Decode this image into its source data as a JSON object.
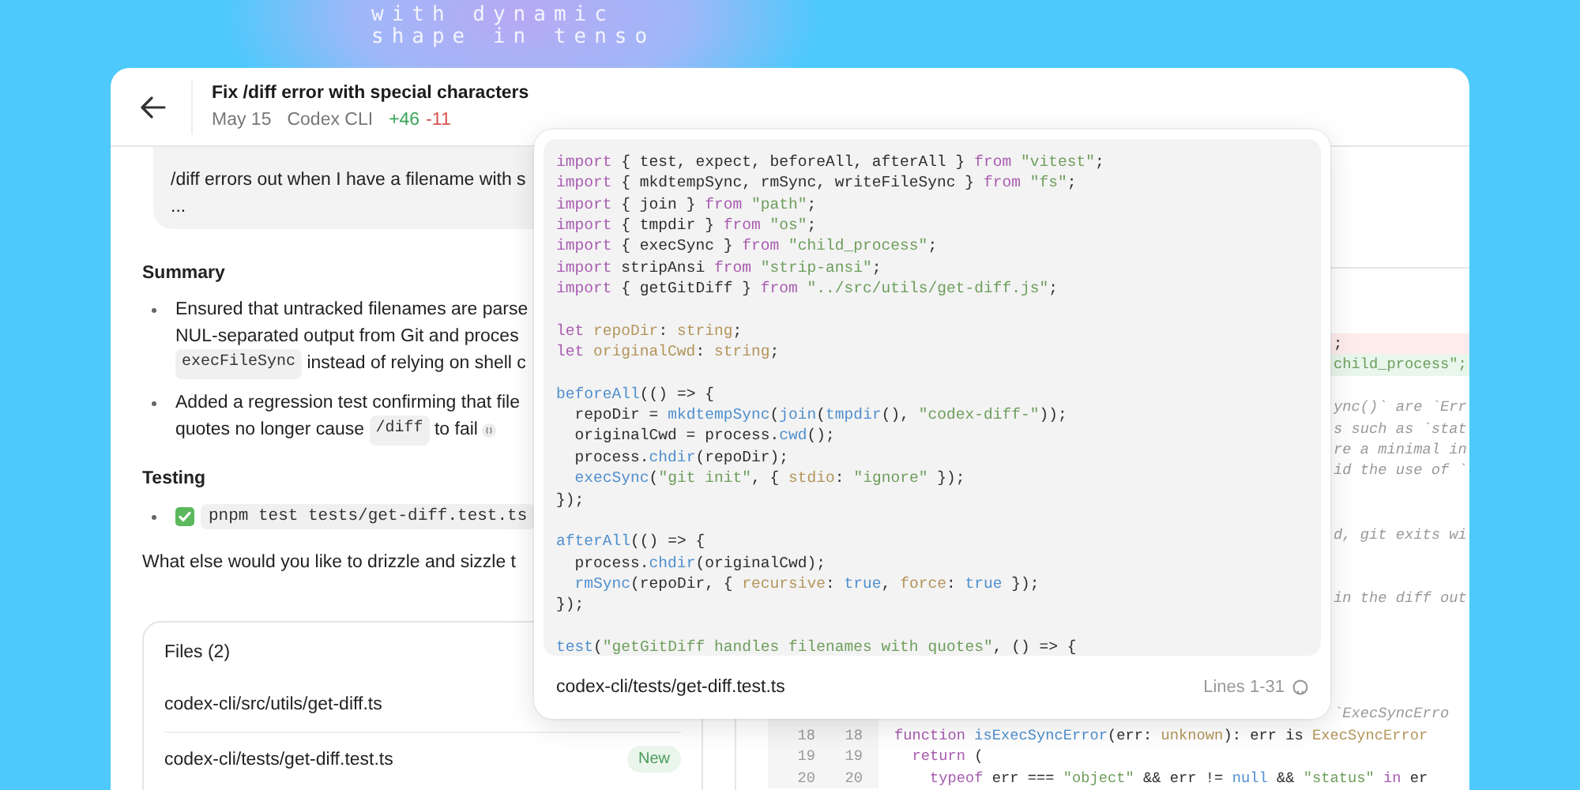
{
  "backdrop": {
    "lines": [
      "with dynamic",
      "shape in tenso"
    ]
  },
  "header": {
    "title": "Fix /diff error with special characters",
    "date": "May 15",
    "source": "Codex CLI",
    "additions": "+46",
    "deletions": "-11"
  },
  "prompt": {
    "lines": [
      "/diff errors out when I have a filename with s",
      "..."
    ]
  },
  "summary": {
    "heading": "Summary",
    "bullets": [
      {
        "citation": false,
        "lines": [
          [
            {
              "kind": "text",
              "text": "Ensured that untracked filenames are parse"
            }
          ],
          [
            {
              "kind": "text",
              "text": "NUL-separated output from Git and proces"
            }
          ],
          [
            {
              "kind": "code",
              "text": "execFileSync"
            },
            {
              "kind": "text",
              "text": " instead of relying on shell c"
            }
          ]
        ]
      },
      {
        "citation": true,
        "lines": [
          [
            {
              "kind": "text",
              "text": "Added a regression test confirming that file"
            }
          ],
          [
            {
              "kind": "text",
              "text": "quotes no longer cause "
            },
            {
              "kind": "code",
              "text": "/diff"
            },
            {
              "kind": "text",
              "text": " to fail"
            }
          ]
        ]
      }
    ]
  },
  "testing": {
    "heading": "Testing",
    "items": [
      {
        "passed": true,
        "command": "pnpm test tests/get-diff.test.ts"
      }
    ]
  },
  "closing": "What else would you like to drizzle and sizzle t",
  "files": {
    "title": "Files (2)",
    "items": [
      {
        "path": "codex-cli/src/utils/get-diff.ts"
      },
      {
        "path": "codex-cli/tests/get-diff.test.ts",
        "badge": "New"
      }
    ]
  },
  "diff": {
    "rows": [
      {
        "kind": "removed",
        "tokens": [
          {
            "kind": "plain",
            "text": ";"
          }
        ]
      },
      {
        "kind": "added",
        "tokens": [
          {
            "kind": "string",
            "text": "child_process\";"
          }
        ]
      },
      {
        "kind": "context",
        "tokens": [
          {
            "kind": "comment",
            "text": "ync()` are `Err"
          }
        ]
      },
      {
        "kind": "context",
        "tokens": [
          {
            "kind": "comment",
            "text": "s such as `stat"
          }
        ]
      },
      {
        "kind": "context",
        "tokens": [
          {
            "kind": "comment",
            "text": "re a minimal in"
          }
        ]
      },
      {
        "kind": "context",
        "tokens": [
          {
            "kind": "comment",
            "text": "id the use of `"
          }
        ]
      },
      {
        "kind": "context",
        "tokens": [
          {
            "kind": "comment",
            "text": "d, git exits wi"
          }
        ]
      },
      {
        "kind": "context",
        "tokens": [
          {
            "kind": "comment",
            "text": "in the diff out"
          }
        ]
      },
      {
        "kind": "context",
        "tokens": [
          {
            "kind": "comment",
            "text": "`ExecSyncErro"
          }
        ]
      },
      {
        "kind": "context",
        "old": "18",
        "new": "18",
        "tokens": [
          {
            "kind": "keyword",
            "text": "function"
          },
          {
            "kind": "function",
            "text": " isExecSyncError"
          },
          {
            "kind": "plain",
            "text": "(err: "
          },
          {
            "kind": "type",
            "text": "unknown"
          },
          {
            "kind": "plain",
            "text": "): err is "
          },
          {
            "kind": "type",
            "text": "ExecSyncError"
          }
        ]
      },
      {
        "kind": "context",
        "old": "19",
        "new": "19",
        "tokens": [
          {
            "kind": "keyword",
            "text": "  return"
          },
          {
            "kind": "plain",
            "text": " ("
          }
        ]
      },
      {
        "kind": "context",
        "old": "20",
        "new": "20",
        "tokens": [
          {
            "kind": "keyword",
            "text": "    typeof"
          },
          {
            "kind": "plain",
            "text": " err === "
          },
          {
            "kind": "string",
            "text": "\"object\""
          },
          {
            "kind": "plain",
            "text": " && err != "
          },
          {
            "kind": "literal",
            "text": "null"
          },
          {
            "kind": "plain",
            "text": " && "
          },
          {
            "kind": "string",
            "text": "\"status\""
          },
          {
            "kind": "keyword",
            "text": " in"
          },
          {
            "kind": "plain",
            "text": " er"
          }
        ]
      }
    ]
  },
  "popover": {
    "path": "codex-cli/tests/get-diff.test.ts",
    "range": "Lines 1-31",
    "blocks": [
      [
        [
          {
            "kind": "keyword",
            "text": "import"
          },
          {
            "kind": "plain",
            "text": " { test, expect, beforeAll, afterAll } "
          },
          {
            "kind": "keyword",
            "text": "from"
          },
          {
            "kind": "string",
            "text": " \"vitest\""
          },
          {
            "kind": "plain",
            "text": ";"
          }
        ],
        [
          {
            "kind": "keyword",
            "text": "import"
          },
          {
            "kind": "plain",
            "text": " { mkdtempSync, rmSync, writeFileSync } "
          },
          {
            "kind": "keyword",
            "text": "from"
          },
          {
            "kind": "string",
            "text": " \"fs\""
          },
          {
            "kind": "plain",
            "text": ";"
          }
        ],
        [
          {
            "kind": "keyword",
            "text": "import"
          },
          {
            "kind": "plain",
            "text": " { join } "
          },
          {
            "kind": "keyword",
            "text": "from"
          },
          {
            "kind": "string",
            "text": " \"path\""
          },
          {
            "kind": "plain",
            "text": ";"
          }
        ],
        [
          {
            "kind": "keyword",
            "text": "import"
          },
          {
            "kind": "plain",
            "text": " { tmpdir } "
          },
          {
            "kind": "keyword",
            "text": "from"
          },
          {
            "kind": "string",
            "text": " \"os\""
          },
          {
            "kind": "plain",
            "text": ";"
          }
        ],
        [
          {
            "kind": "keyword",
            "text": "import"
          },
          {
            "kind": "plain",
            "text": " { execSync } "
          },
          {
            "kind": "keyword",
            "text": "from"
          },
          {
            "kind": "string",
            "text": " \"child_process\""
          },
          {
            "kind": "plain",
            "text": ";"
          }
        ],
        [
          {
            "kind": "keyword",
            "text": "import"
          },
          {
            "kind": "plain",
            "text": " stripAnsi "
          },
          {
            "kind": "keyword",
            "text": "from"
          },
          {
            "kind": "string",
            "text": " \"strip-ansi\""
          },
          {
            "kind": "plain",
            "text": ";"
          }
        ],
        [
          {
            "kind": "keyword",
            "text": "import"
          },
          {
            "kind": "plain",
            "text": " { getGitDiff } "
          },
          {
            "kind": "keyword",
            "text": "from"
          },
          {
            "kind": "string",
            "text": " \"../src/utils/get-diff.js\""
          },
          {
            "kind": "plain",
            "text": ";"
          }
        ]
      ],
      [
        [
          {
            "kind": "keyword",
            "text": "let"
          },
          {
            "kind": "property",
            "text": " repoDir"
          },
          {
            "kind": "plain",
            "text": ": "
          },
          {
            "kind": "type",
            "text": "string"
          },
          {
            "kind": "plain",
            "text": ";"
          }
        ],
        [
          {
            "kind": "keyword",
            "text": "let"
          },
          {
            "kind": "property",
            "text": " originalCwd"
          },
          {
            "kind": "plain",
            "text": ": "
          },
          {
            "kind": "type",
            "text": "string"
          },
          {
            "kind": "plain",
            "text": ";"
          }
        ]
      ],
      [
        [
          {
            "kind": "function",
            "text": "beforeAll"
          },
          {
            "kind": "plain",
            "text": "(() => {"
          }
        ],
        [
          {
            "kind": "plain",
            "text": "  repoDir = "
          },
          {
            "kind": "function",
            "text": "mkdtempSync"
          },
          {
            "kind": "plain",
            "text": "("
          },
          {
            "kind": "function",
            "text": "join"
          },
          {
            "kind": "plain",
            "text": "("
          },
          {
            "kind": "function",
            "text": "tmpdir"
          },
          {
            "kind": "plain",
            "text": "(), "
          },
          {
            "kind": "string",
            "text": "\"codex-diff-\""
          },
          {
            "kind": "plain",
            "text": "));"
          }
        ],
        [
          {
            "kind": "plain",
            "text": "  originalCwd = process."
          },
          {
            "kind": "function",
            "text": "cwd"
          },
          {
            "kind": "plain",
            "text": "();"
          }
        ],
        [
          {
            "kind": "plain",
            "text": "  process."
          },
          {
            "kind": "function",
            "text": "chdir"
          },
          {
            "kind": "plain",
            "text": "(repoDir);"
          }
        ],
        [
          {
            "kind": "function",
            "text": "  execSync"
          },
          {
            "kind": "plain",
            "text": "("
          },
          {
            "kind": "string",
            "text": "\"git init\""
          },
          {
            "kind": "plain",
            "text": ", { "
          },
          {
            "kind": "property",
            "text": "stdio"
          },
          {
            "kind": "plain",
            "text": ": "
          },
          {
            "kind": "string",
            "text": "\"ignore\""
          },
          {
            "kind": "plain",
            "text": " });"
          }
        ],
        [
          {
            "kind": "plain",
            "text": "});"
          }
        ]
      ],
      [
        [
          {
            "kind": "function",
            "text": "afterAll"
          },
          {
            "kind": "plain",
            "text": "(() => {"
          }
        ],
        [
          {
            "kind": "plain",
            "text": "  process."
          },
          {
            "kind": "function",
            "text": "chdir"
          },
          {
            "kind": "plain",
            "text": "(originalCwd);"
          }
        ],
        [
          {
            "kind": "function",
            "text": "  rmSync"
          },
          {
            "kind": "plain",
            "text": "(repoDir, { "
          },
          {
            "kind": "property",
            "text": "recursive"
          },
          {
            "kind": "plain",
            "text": ": "
          },
          {
            "kind": "literal",
            "text": "true"
          },
          {
            "kind": "plain",
            "text": ", "
          },
          {
            "kind": "property",
            "text": "force"
          },
          {
            "kind": "plain",
            "text": ": "
          },
          {
            "kind": "literal",
            "text": "true"
          },
          {
            "kind": "plain",
            "text": " });"
          }
        ],
        [
          {
            "kind": "plain",
            "text": "});"
          }
        ]
      ],
      [
        [
          {
            "kind": "function",
            "text": "test"
          },
          {
            "kind": "plain",
            "text": "("
          },
          {
            "kind": "string",
            "text": "\"getGitDiff handles filenames with quotes\""
          },
          {
            "kind": "plain",
            "text": ", () => {"
          }
        ]
      ]
    ]
  }
}
